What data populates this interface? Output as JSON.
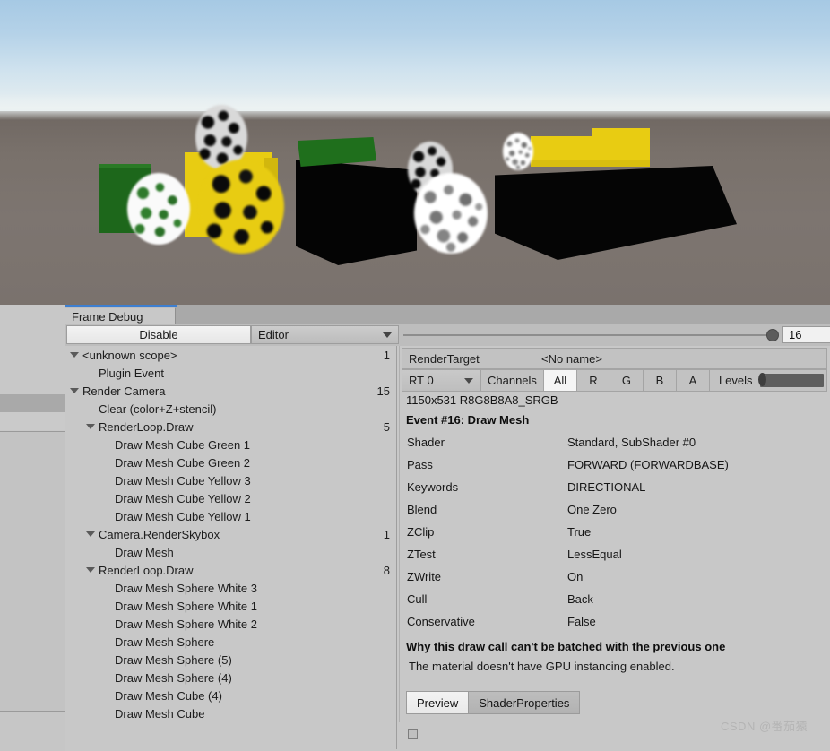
{
  "window": {
    "tab_label": "Frame Debug",
    "accent_color": "#3d7fd1"
  },
  "toolbar": {
    "disable_label": "Disable",
    "target_dropdown": "Editor",
    "event_index_value": "16"
  },
  "tree": {
    "items": [
      {
        "label": "<unknown scope>",
        "depth": 0,
        "expanded": true,
        "count": "1"
      },
      {
        "label": "Plugin Event",
        "depth": 1,
        "expanded": false,
        "count": ""
      },
      {
        "label": "Render Camera",
        "depth": 0,
        "expanded": true,
        "count": "15"
      },
      {
        "label": "Clear (color+Z+stencil)",
        "depth": 1,
        "expanded": false,
        "count": ""
      },
      {
        "label": "RenderLoop.Draw",
        "depth": 1,
        "expanded": true,
        "count": "5"
      },
      {
        "label": "Draw Mesh Cube Green 1",
        "depth": 2,
        "expanded": false,
        "count": ""
      },
      {
        "label": "Draw Mesh Cube Green 2",
        "depth": 2,
        "expanded": false,
        "count": ""
      },
      {
        "label": "Draw Mesh Cube Yellow 3",
        "depth": 2,
        "expanded": false,
        "count": ""
      },
      {
        "label": "Draw Mesh Cube Yellow 2",
        "depth": 2,
        "expanded": false,
        "count": ""
      },
      {
        "label": "Draw Mesh Cube Yellow 1",
        "depth": 2,
        "expanded": false,
        "count": ""
      },
      {
        "label": "Camera.RenderSkybox",
        "depth": 1,
        "expanded": true,
        "count": "1"
      },
      {
        "label": "Draw Mesh",
        "depth": 2,
        "expanded": false,
        "count": ""
      },
      {
        "label": "RenderLoop.Draw",
        "depth": 1,
        "expanded": true,
        "count": "8"
      },
      {
        "label": "Draw Mesh Sphere White 3",
        "depth": 2,
        "expanded": false,
        "count": ""
      },
      {
        "label": "Draw Mesh Sphere White 1",
        "depth": 2,
        "expanded": false,
        "count": ""
      },
      {
        "label": "Draw Mesh Sphere White 2",
        "depth": 2,
        "expanded": false,
        "count": ""
      },
      {
        "label": "Draw Mesh Sphere",
        "depth": 2,
        "expanded": false,
        "count": ""
      },
      {
        "label": "Draw Mesh Sphere (5)",
        "depth": 2,
        "expanded": false,
        "count": ""
      },
      {
        "label": "Draw Mesh Sphere (4)",
        "depth": 2,
        "expanded": false,
        "count": ""
      },
      {
        "label": "Draw Mesh Cube (4)",
        "depth": 2,
        "expanded": false,
        "count": ""
      },
      {
        "label": "Draw Mesh Cube",
        "depth": 2,
        "expanded": false,
        "count": ""
      }
    ]
  },
  "detail": {
    "render_target_label": "RenderTarget",
    "render_target_name": "<No name>",
    "rt_select": "RT 0",
    "channels_label": "Channels",
    "channels": [
      {
        "label": "All",
        "selected": true
      },
      {
        "label": "R",
        "selected": false
      },
      {
        "label": "G",
        "selected": false
      },
      {
        "label": "B",
        "selected": false
      },
      {
        "label": "A",
        "selected": false
      }
    ],
    "levels_label": "Levels",
    "rt_info": "1150x531 R8G8B8A8_SRGB",
    "event_title": "Event #16: Draw Mesh",
    "properties": [
      {
        "key": "Shader",
        "value": "Standard, SubShader #0"
      },
      {
        "key": "Pass",
        "value": "FORWARD (FORWARDBASE)"
      },
      {
        "key": "Keywords",
        "value": "DIRECTIONAL"
      },
      {
        "key": "Blend",
        "value": "One Zero"
      },
      {
        "key": "ZClip",
        "value": "True"
      },
      {
        "key": "ZTest",
        "value": "LessEqual"
      },
      {
        "key": "ZWrite",
        "value": "On"
      },
      {
        "key": "Cull",
        "value": "Back"
      },
      {
        "key": "Conservative",
        "value": "False"
      }
    ],
    "batch_title": "Why this draw call can't be batched with the previous one",
    "batch_message": "The material doesn't have GPU instancing enabled.",
    "preview_tabs": [
      {
        "label": "Preview",
        "selected": true
      },
      {
        "label": "ShaderProperties",
        "selected": false
      }
    ]
  },
  "scene": {
    "sky_color": "#b5d2e8",
    "ground_color": "#7a726d",
    "green_color": "#1f6b1d",
    "yellow_color": "#e8cc12",
    "black_color": "#050505"
  },
  "watermark": "CSDN @番茄猿"
}
